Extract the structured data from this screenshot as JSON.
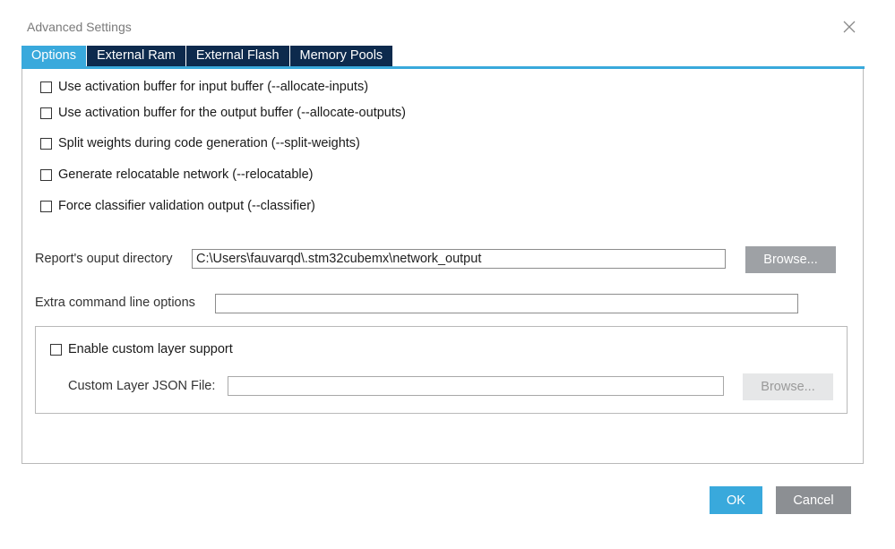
{
  "dialog": {
    "title": "Advanced Settings"
  },
  "tabs": [
    {
      "label": "Options",
      "active": true
    },
    {
      "label": "External Ram",
      "active": false
    },
    {
      "label": "External Flash",
      "active": false
    },
    {
      "label": "Memory Pools",
      "active": false
    }
  ],
  "options": [
    {
      "label": "Use activation buffer for input buffer (--allocate-inputs)",
      "checked": false
    },
    {
      "label": "Use activation buffer for the output buffer (--allocate-outputs)",
      "checked": false
    },
    {
      "label": "Split weights during code generation (--split-weights)",
      "checked": false
    },
    {
      "label": "Generate relocatable network (--relocatable)",
      "checked": false
    },
    {
      "label": "Force classifier validation output (--classifier)",
      "checked": false
    }
  ],
  "report_dir": {
    "label": "Report's ouput directory",
    "value": "C:\\Users\\fauvarqd\\.stm32cubemx\\network_output",
    "browse_label": "Browse..."
  },
  "extra_options": {
    "label": "Extra command line options",
    "value": ""
  },
  "custom_layer": {
    "enable_label": "Enable custom layer support",
    "enabled": false,
    "json_label": "Custom Layer JSON File:",
    "json_value": "",
    "browse_label": "Browse..."
  },
  "footer": {
    "ok_label": "OK",
    "cancel_label": "Cancel"
  },
  "colors": {
    "accent": "#39a9dc",
    "tab_inactive": "#0d2a4d",
    "cancel": "#8c8f93",
    "browse": "#9ea1a5"
  }
}
